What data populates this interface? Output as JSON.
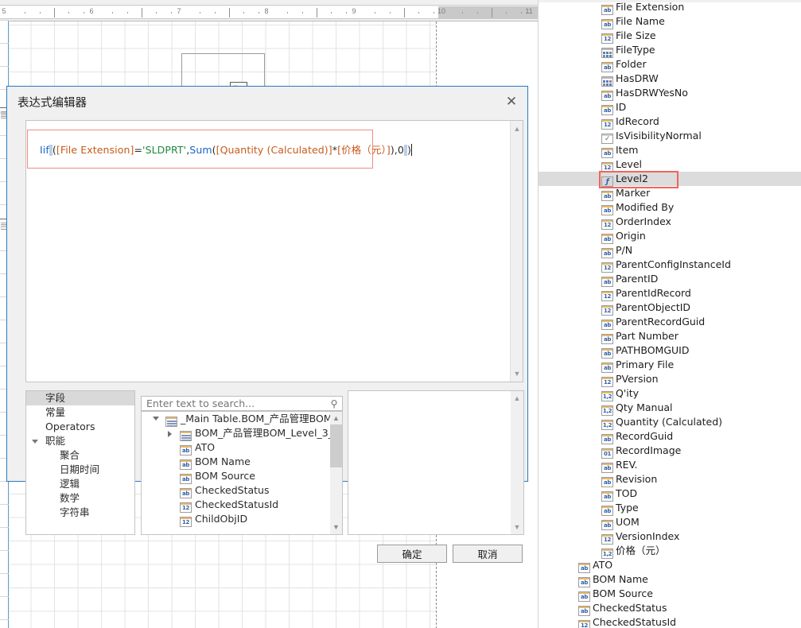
{
  "designer": {
    "ruler": {
      "unit_numbers": [
        "5",
        "6",
        "7",
        "8",
        "9",
        "10",
        "11"
      ],
      "orientation": "horizontal"
    },
    "band_icon_name": "data-source-field-icon"
  },
  "dialog": {
    "title": "表达式编辑器",
    "close_label": "✕",
    "expression": {
      "tokens": [
        {
          "text": "Iif",
          "kind": "fn"
        },
        {
          "text": "(",
          "kind": "plain"
        },
        {
          "text": "[File Extension]",
          "kind": "field"
        },
        {
          "text": "=",
          "kind": "plain"
        },
        {
          "text": "'SLDPRT'",
          "kind": "str"
        },
        {
          "text": ",",
          "kind": "plain"
        },
        {
          "text": "Sum",
          "kind": "fn"
        },
        {
          "text": "(",
          "kind": "plain"
        },
        {
          "text": "[Quantity (Calculated)]",
          "kind": "field"
        },
        {
          "text": "*",
          "kind": "plain"
        },
        {
          "text": "[价格（元）]",
          "kind": "field"
        },
        {
          "text": ")",
          "kind": "plain"
        },
        {
          "text": ",",
          "kind": "plain"
        },
        {
          "text": "0",
          "kind": "num"
        },
        {
          "text": ")",
          "kind": "plain"
        }
      ],
      "plain_text": "Iif([File Extension]='SLDPRT',Sum([Quantity (Calculated)]*[价格（元）]),0)"
    },
    "categories": [
      {
        "label": "字段",
        "selected": true,
        "level": 0,
        "expander": "none"
      },
      {
        "label": "常量",
        "selected": false,
        "level": 0,
        "expander": "none"
      },
      {
        "label": "Operators",
        "selected": false,
        "level": 0,
        "expander": "none"
      },
      {
        "label": "职能",
        "selected": false,
        "level": 0,
        "expander": "open"
      },
      {
        "label": "聚合",
        "selected": false,
        "level": 1,
        "expander": "none"
      },
      {
        "label": "日期时间",
        "selected": false,
        "level": 1,
        "expander": "none"
      },
      {
        "label": "逻辑",
        "selected": false,
        "level": 1,
        "expander": "none"
      },
      {
        "label": "数学",
        "selected": false,
        "level": 1,
        "expander": "none"
      },
      {
        "label": "字符串",
        "selected": false,
        "level": 1,
        "expander": "none"
      }
    ],
    "search": {
      "placeholder": "Enter text to search...",
      "value": "",
      "icon": "search-icon"
    },
    "tree": [
      {
        "label": "_Main Table.BOM_产品管理BOM_...",
        "icon": "table",
        "indent": 30,
        "expander": "open"
      },
      {
        "label": "BOM_产品管理BOM_Level_3_...",
        "icon": "table",
        "indent": 48,
        "expander": "closed"
      },
      {
        "label": "ATO",
        "icon": "ab",
        "indent": 48,
        "expander": "none"
      },
      {
        "label": "BOM Name",
        "icon": "ab",
        "indent": 48,
        "expander": "none"
      },
      {
        "label": "BOM Source",
        "icon": "ab",
        "indent": 48,
        "expander": "none"
      },
      {
        "label": "CheckedStatus",
        "icon": "ab",
        "indent": 48,
        "expander": "none"
      },
      {
        "label": "CheckedStatusId",
        "icon": "12",
        "indent": 48,
        "expander": "none"
      },
      {
        "label": "ChildObjID",
        "icon": "12",
        "indent": 48,
        "expander": "none"
      }
    ],
    "description": "",
    "buttons": {
      "ok": "确定",
      "cancel": "取消"
    }
  },
  "field_list": {
    "selected": "Level2",
    "annotation_color": "#f2645c",
    "items": [
      {
        "label": "File Extension",
        "icon": "ab",
        "level": 1
      },
      {
        "label": "File Name",
        "icon": "ab",
        "level": 1
      },
      {
        "label": "File Size",
        "icon": "12",
        "level": 1
      },
      {
        "label": "FileType",
        "icon": "table2",
        "level": 1
      },
      {
        "label": "Folder",
        "icon": "ab",
        "level": 1
      },
      {
        "label": "HasDRW",
        "icon": "table2",
        "level": 1
      },
      {
        "label": "HasDRWYesNo",
        "icon": "ab",
        "level": 1
      },
      {
        "label": "ID",
        "icon": "ab",
        "level": 1
      },
      {
        "label": "IdRecord",
        "icon": "12",
        "level": 1
      },
      {
        "label": "IsVisibilityNormal",
        "icon": "bool",
        "level": 1
      },
      {
        "label": "Item",
        "icon": "ab",
        "level": 1
      },
      {
        "label": "Level",
        "icon": "12",
        "level": 1
      },
      {
        "label": "Level2",
        "icon": "fn",
        "level": 1,
        "selected": true
      },
      {
        "label": "Marker",
        "icon": "ab",
        "level": 1
      },
      {
        "label": "Modified By",
        "icon": "ab",
        "level": 1
      },
      {
        "label": "OrderIndex",
        "icon": "12",
        "level": 1
      },
      {
        "label": "Origin",
        "icon": "ab",
        "level": 1
      },
      {
        "label": "P/N",
        "icon": "ab",
        "level": 1
      },
      {
        "label": "ParentConfigInstanceId",
        "icon": "12",
        "level": 1
      },
      {
        "label": "ParentID",
        "icon": "ab",
        "level": 1
      },
      {
        "label": "ParentIdRecord",
        "icon": "12",
        "level": 1
      },
      {
        "label": "ParentObjectID",
        "icon": "12",
        "level": 1
      },
      {
        "label": "ParentRecordGuid",
        "icon": "ab",
        "level": 1
      },
      {
        "label": "Part Number",
        "icon": "ab",
        "level": 1
      },
      {
        "label": "PATHBOMGUID",
        "icon": "ab",
        "level": 1
      },
      {
        "label": "Primary File",
        "icon": "ab",
        "level": 1
      },
      {
        "label": "PVersion",
        "icon": "12",
        "level": 1
      },
      {
        "label": "Q'ity",
        "icon": "12d",
        "level": 1
      },
      {
        "label": "Qty Manual",
        "icon": "12d",
        "level": 1
      },
      {
        "label": "Quantity (Calculated)",
        "icon": "12d",
        "level": 1
      },
      {
        "label": "RecordGuid",
        "icon": "ab",
        "level": 1
      },
      {
        "label": "RecordImage",
        "icon": "01",
        "level": 1
      },
      {
        "label": "REV.",
        "icon": "ab",
        "level": 1
      },
      {
        "label": "Revision",
        "icon": "ab",
        "level": 1
      },
      {
        "label": "TOD",
        "icon": "ab",
        "level": 1
      },
      {
        "label": "Type",
        "icon": "ab",
        "level": 1
      },
      {
        "label": "UOM",
        "icon": "ab",
        "level": 1
      },
      {
        "label": "VersionIndex",
        "icon": "12",
        "level": 1
      },
      {
        "label": "价格（元）",
        "icon": "12d",
        "level": 1
      },
      {
        "label": "ATO",
        "icon": "ab",
        "level": 0
      },
      {
        "label": "BOM Name",
        "icon": "ab",
        "level": 0
      },
      {
        "label": "BOM Source",
        "icon": "ab",
        "level": 0
      },
      {
        "label": "CheckedStatus",
        "icon": "ab",
        "level": 0
      },
      {
        "label": "CheckedStatusId",
        "icon": "12",
        "level": 0
      }
    ]
  }
}
